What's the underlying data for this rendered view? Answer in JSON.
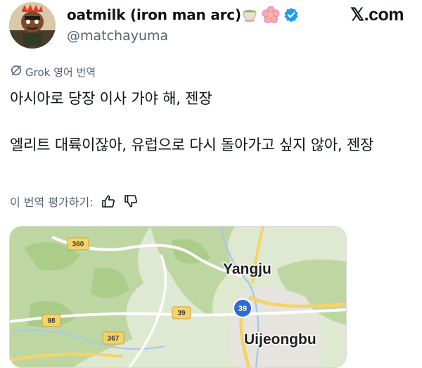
{
  "header": {
    "display_name": "oatmilk (iron man arc)",
    "handle": "@matchayuma",
    "badge_icons": [
      "tea-cup-icon",
      "cherry-blossom-icon",
      "verified-badge-icon"
    ],
    "site_logo": "𝕏.com"
  },
  "translation": {
    "label": "Grok 영어 번역"
  },
  "post": {
    "text": "아시아로 당장 이사 가야 해, 젠장\n\n엘리트 대륙이잖아, 유럽으로 다시 돌아가고 싶지 않아, 젠장"
  },
  "rating": {
    "label": "이 번역 평가하기:"
  },
  "map": {
    "city_labels": [
      "Yangju",
      "Uijeongbu"
    ],
    "road_labels": [
      "360",
      "98",
      "39",
      "367"
    ],
    "highway_label": "39"
  },
  "colors": {
    "verified": "#1d9bf0",
    "secondary_text": "#536471",
    "map_green": "#cfe3b4",
    "road_yellow": "#f4d46a"
  }
}
